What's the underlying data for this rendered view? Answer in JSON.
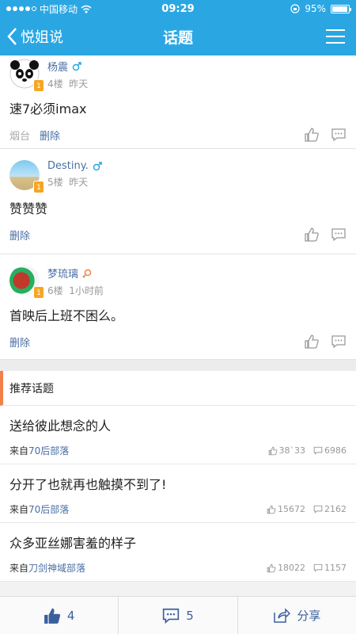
{
  "status": {
    "carrier": "中国移动",
    "time": "09:29",
    "battery": "95%",
    "battery_level": 0.95
  },
  "nav": {
    "back_label": "悦姐说",
    "title": "话题"
  },
  "comments": [
    {
      "user": "杨震",
      "floor": "4楼",
      "time": "昨天",
      "text": "速7必须imax",
      "source": "烟台",
      "delete_label": "删除",
      "gender": "male"
    },
    {
      "user": "Destiny.",
      "floor": "5楼",
      "time": "昨天",
      "text": "赞赞赞",
      "delete_label": "删除",
      "gender": "male"
    },
    {
      "user": "梦琉璃",
      "floor": "6楼",
      "time": "1小时前",
      "text": "首映后上班不困么。",
      "delete_label": "删除",
      "gender": "female"
    }
  ],
  "recommended": {
    "header": "推荐话题",
    "topics": [
      {
        "title": "送给彼此想念的人",
        "source_prefix": "来自",
        "group": "70后部落",
        "likes": "38`33",
        "comments": "6986"
      },
      {
        "title": "分开了也就再也触摸不到了!",
        "source_prefix": "来自",
        "group": "70后部落",
        "likes": "15672",
        "comments": "2162"
      },
      {
        "title": "众多亚丝娜害羞的样子",
        "source_prefix": "来自",
        "group": "刀剑神域部落",
        "likes": "18022",
        "comments": "1157"
      }
    ]
  },
  "bottom": {
    "like_count": "4",
    "comment_count": "5",
    "share_label": "分享"
  },
  "level_badge": "1",
  "colors": {
    "primary": "#2aa7e3",
    "link": "#4a6fa5",
    "accent": "#f2804a",
    "badge": "#f5a623"
  }
}
